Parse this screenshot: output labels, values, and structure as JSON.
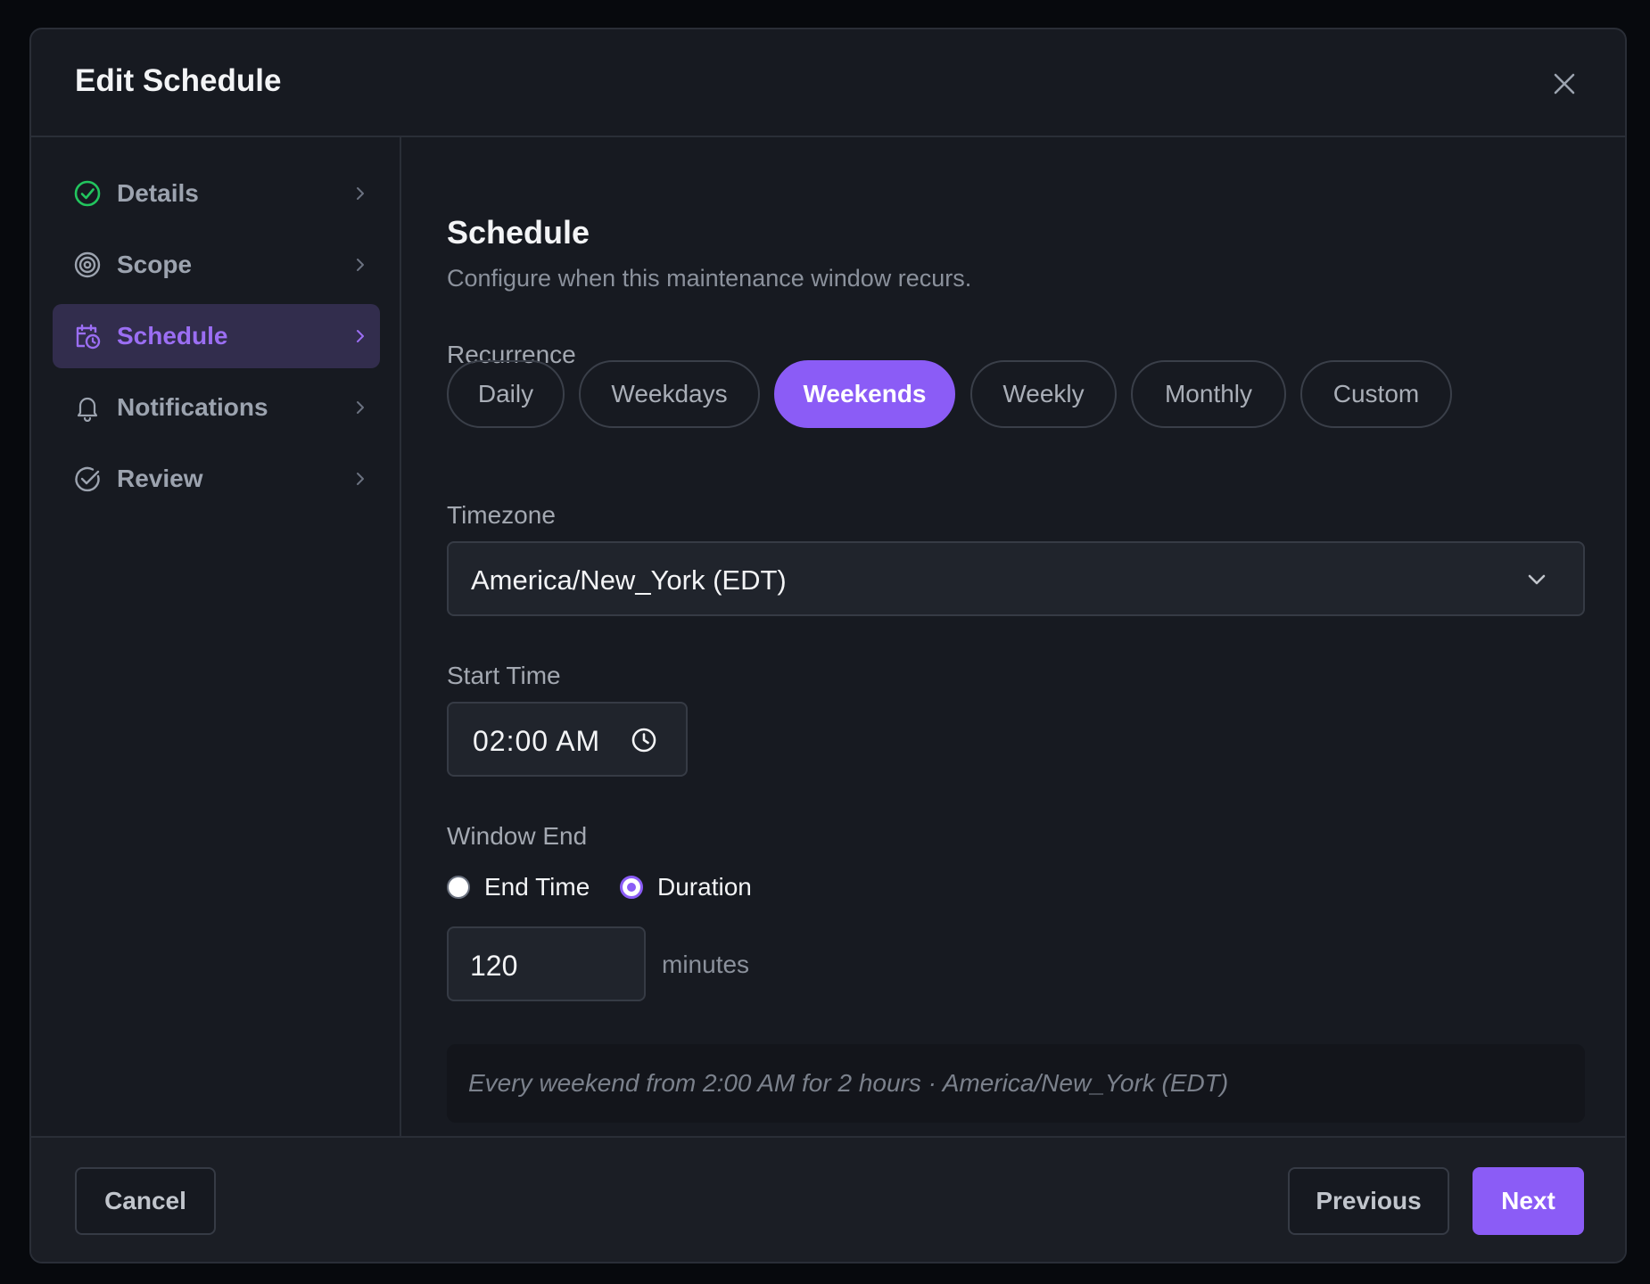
{
  "dialog": {
    "title": "Edit Schedule"
  },
  "sidebar": {
    "items": [
      {
        "label": "Details",
        "icon": "check-circle-icon",
        "status": "complete"
      },
      {
        "label": "Scope",
        "icon": "target-icon"
      },
      {
        "label": "Schedule",
        "icon": "calendar-clock-icon",
        "active": true
      },
      {
        "label": "Notifications",
        "icon": "bell-icon"
      },
      {
        "label": "Review",
        "icon": "check-circle-icon"
      }
    ]
  },
  "main": {
    "title": "Schedule",
    "subtitle": "Configure when this maintenance window recurs.",
    "recurrence": {
      "label": "Recurrence",
      "options": [
        "Daily",
        "Weekdays",
        "Weekends",
        "Weekly",
        "Monthly",
        "Custom"
      ],
      "selected": "Weekends"
    },
    "timezone": {
      "label": "Timezone",
      "value": "America/New_York (EDT)"
    },
    "start_time": {
      "label": "Start Time",
      "value": "02:00 AM"
    },
    "window_end": {
      "label": "Window End",
      "options": [
        "End Time",
        "Duration"
      ],
      "selected": "Duration",
      "duration_value": "120",
      "duration_unit": "minutes"
    },
    "summary": "Every weekend from 2:00 AM for 2 hours · America/New_York (EDT)"
  },
  "footer": {
    "cancel_label": "Cancel",
    "previous_label": "Previous",
    "next_label": "Next"
  },
  "colors": {
    "accent": "#8b5cf6",
    "success": "#22c55e",
    "background": "#171a21"
  }
}
